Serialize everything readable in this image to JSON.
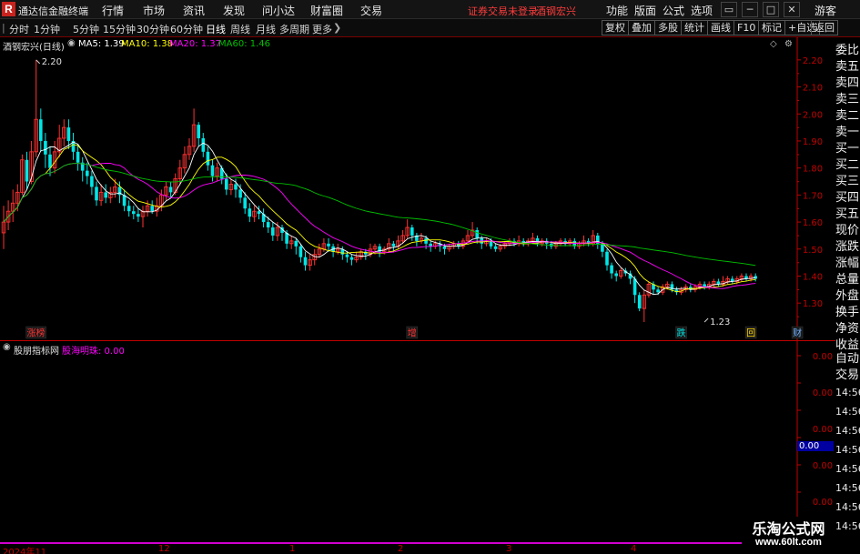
{
  "titlebar": {
    "logo": "R",
    "app_title": "通达信金融终端",
    "menu": [
      "行情",
      "市场",
      "资讯",
      "发现",
      "问小达",
      "财富圈",
      "交易"
    ],
    "warning": "证券交易未登录",
    "stock_name": "酒钢宏兴",
    "right_menu": [
      "功能",
      "版面",
      "公式",
      "选项"
    ],
    "guest_label": "游客",
    "window_buttons": [
      "▭",
      "─",
      "□",
      "✕"
    ]
  },
  "toolbar": {
    "periods": [
      "分时",
      "1分钟",
      "5分钟",
      "15分钟",
      "30分钟",
      "60分钟",
      "日线",
      "周线",
      "月线",
      "多周期",
      "更多"
    ],
    "active_period": "日线",
    "right_buttons": [
      "复权",
      "叠加",
      "多股",
      "统计",
      "画线",
      "F10",
      "标记",
      "+自选",
      "返回"
    ]
  },
  "chart_header": {
    "stock_label": "酒钢宏兴(日线)",
    "ma5": "MA5: 1.39",
    "ma10": "MA10: 1.38",
    "ma20": "MA20: 1.37",
    "ma60": "MA60: 1.46"
  },
  "indicator_header": {
    "name": "股朋指标网",
    "series_label": "股海明珠: 0.00",
    "current_value": "0.00"
  },
  "sidebar": {
    "items": [
      "委比",
      "卖五",
      "卖四",
      "卖三",
      "卖二",
      "卖一",
      "买一",
      "买二",
      "买三",
      "买四",
      "买五",
      "现价",
      "涨跌",
      "涨幅",
      "总量",
      "外盘",
      "换手",
      "净资",
      "收益"
    ],
    "bottom_items": [
      "自动",
      "交易"
    ],
    "times": [
      "14:56",
      "14:56",
      "14:56",
      "14:56",
      "14:56",
      "14:56",
      "14:56",
      "14:56"
    ]
  },
  "date_axis": {
    "labels": [
      "2024年11",
      "12",
      "1",
      "2",
      "3",
      "4"
    ]
  },
  "watermark": {
    "line1": "乐淘公式网",
    "line2": "www.60lt.com"
  },
  "colors": {
    "up": "#ff3232",
    "down": "#00e6e6",
    "ma5": "#ffffff",
    "ma10": "#ffff00",
    "ma20": "#ff00ff",
    "ma60": "#00c000",
    "axis_red": "#c00000"
  },
  "chart_data": [
    {
      "type": "candlestick",
      "title": "酒钢宏兴(日线)",
      "y_ticks": [
        1.3,
        1.4,
        1.5,
        1.6,
        1.7,
        1.8,
        1.9,
        2.0,
        2.1,
        2.2
      ],
      "ylim": [
        1.24,
        2.25
      ],
      "annotations": [
        {
          "text": "2.20",
          "value": 2.2,
          "index": 7
        },
        {
          "text": "1.23",
          "value": 1.23,
          "index": 151
        }
      ],
      "markers": [
        {
          "text": "涨榜",
          "index": 6,
          "color": "#ff3232"
        },
        {
          "text": "增",
          "index": 88,
          "color": "#ff3232"
        },
        {
          "text": "跌",
          "index": 146,
          "color": "#00e6e6"
        },
        {
          "text": "回",
          "index": 161,
          "color": "#ffd700"
        },
        {
          "text": "财",
          "index": 171,
          "color": "#6fb0ff"
        }
      ],
      "series": [
        {
          "name": "MA5",
          "value": 1.39
        },
        {
          "name": "MA10",
          "value": 1.38
        },
        {
          "name": "MA20",
          "value": 1.37
        },
        {
          "name": "MA60",
          "value": 1.46
        }
      ],
      "candles": [
        [
          1.56,
          1.6,
          1.66,
          1.5
        ],
        [
          1.6,
          1.64,
          1.68,
          1.57
        ],
        [
          1.64,
          1.67,
          1.72,
          1.6
        ],
        [
          1.67,
          1.71,
          1.74,
          1.64
        ],
        [
          1.71,
          1.83,
          1.85,
          1.7
        ],
        [
          1.83,
          1.75,
          1.86,
          1.72
        ],
        [
          1.75,
          1.86,
          1.9,
          1.74
        ],
        [
          1.86,
          1.98,
          2.2,
          1.84
        ],
        [
          1.98,
          1.9,
          2.02,
          1.86
        ],
        [
          1.9,
          1.85,
          1.93,
          1.8
        ],
        [
          1.85,
          1.8,
          1.88,
          1.77
        ],
        [
          1.8,
          1.86,
          1.9,
          1.78
        ],
        [
          1.86,
          1.91,
          1.96,
          1.84
        ],
        [
          1.91,
          1.95,
          1.98,
          1.88
        ],
        [
          1.95,
          1.9,
          1.98,
          1.87
        ],
        [
          1.9,
          1.86,
          1.93,
          1.83
        ],
        [
          1.86,
          1.82,
          1.89,
          1.79
        ],
        [
          1.82,
          1.79,
          1.84,
          1.75
        ],
        [
          1.79,
          1.77,
          1.82,
          1.74
        ],
        [
          1.77,
          1.73,
          1.79,
          1.7
        ],
        [
          1.73,
          1.68,
          1.75,
          1.66
        ],
        [
          1.68,
          1.71,
          1.74,
          1.66
        ],
        [
          1.71,
          1.69,
          1.74,
          1.67
        ],
        [
          1.69,
          1.71,
          1.73,
          1.67
        ],
        [
          1.71,
          1.73,
          1.76,
          1.69
        ],
        [
          1.73,
          1.7,
          1.75,
          1.67
        ],
        [
          1.7,
          1.66,
          1.72,
          1.64
        ],
        [
          1.66,
          1.64,
          1.68,
          1.62
        ],
        [
          1.64,
          1.63,
          1.66,
          1.61
        ],
        [
          1.63,
          1.62,
          1.65,
          1.6
        ],
        [
          1.62,
          1.64,
          1.66,
          1.58
        ],
        [
          1.64,
          1.66,
          1.68,
          1.62
        ],
        [
          1.66,
          1.64,
          1.68,
          1.63
        ],
        [
          1.64,
          1.66,
          1.69,
          1.62
        ],
        [
          1.66,
          1.7,
          1.72,
          1.64
        ],
        [
          1.7,
          1.73,
          1.75,
          1.68
        ],
        [
          1.73,
          1.71,
          1.75,
          1.69
        ],
        [
          1.71,
          1.76,
          1.78,
          1.7
        ],
        [
          1.76,
          1.8,
          1.83,
          1.74
        ],
        [
          1.8,
          1.85,
          1.88,
          1.78
        ],
        [
          1.85,
          1.88,
          1.91,
          1.83
        ],
        [
          1.88,
          1.96,
          2.02,
          1.86
        ],
        [
          1.96,
          1.91,
          1.97,
          1.88
        ],
        [
          1.91,
          1.86,
          1.93,
          1.84
        ],
        [
          1.86,
          1.81,
          1.88,
          1.79
        ],
        [
          1.81,
          1.77,
          1.83,
          1.75
        ],
        [
          1.77,
          1.8,
          1.82,
          1.75
        ],
        [
          1.8,
          1.76,
          1.81,
          1.74
        ],
        [
          1.76,
          1.72,
          1.78,
          1.7
        ],
        [
          1.72,
          1.74,
          1.76,
          1.7
        ],
        [
          1.74,
          1.72,
          1.76,
          1.69
        ],
        [
          1.72,
          1.69,
          1.74,
          1.67
        ],
        [
          1.69,
          1.65,
          1.71,
          1.63
        ],
        [
          1.65,
          1.62,
          1.67,
          1.6
        ],
        [
          1.62,
          1.64,
          1.66,
          1.6
        ],
        [
          1.64,
          1.63,
          1.66,
          1.61
        ],
        [
          1.63,
          1.6,
          1.65,
          1.58
        ],
        [
          1.6,
          1.58,
          1.62,
          1.56
        ],
        [
          1.58,
          1.55,
          1.6,
          1.53
        ],
        [
          1.55,
          1.58,
          1.6,
          1.53
        ],
        [
          1.58,
          1.56,
          1.59,
          1.53
        ],
        [
          1.56,
          1.52,
          1.57,
          1.5
        ],
        [
          1.52,
          1.53,
          1.55,
          1.5
        ],
        [
          1.53,
          1.51,
          1.54,
          1.48
        ],
        [
          1.51,
          1.47,
          1.52,
          1.45
        ],
        [
          1.47,
          1.44,
          1.49,
          1.42
        ],
        [
          1.44,
          1.46,
          1.48,
          1.42
        ],
        [
          1.46,
          1.48,
          1.5,
          1.44
        ],
        [
          1.48,
          1.5,
          1.52,
          1.47
        ],
        [
          1.5,
          1.52,
          1.54,
          1.49
        ],
        [
          1.52,
          1.51,
          1.54,
          1.49
        ],
        [
          1.51,
          1.49,
          1.52,
          1.47
        ],
        [
          1.49,
          1.5,
          1.52,
          1.48
        ],
        [
          1.5,
          1.48,
          1.51,
          1.46
        ],
        [
          1.48,
          1.47,
          1.49,
          1.45
        ],
        [
          1.47,
          1.46,
          1.48,
          1.44
        ],
        [
          1.46,
          1.47,
          1.49,
          1.45
        ],
        [
          1.47,
          1.49,
          1.5,
          1.46
        ],
        [
          1.49,
          1.48,
          1.5,
          1.46
        ],
        [
          1.48,
          1.5,
          1.52,
          1.47
        ],
        [
          1.5,
          1.51,
          1.52,
          1.48
        ],
        [
          1.51,
          1.49,
          1.52,
          1.47
        ],
        [
          1.49,
          1.5,
          1.51,
          1.48
        ],
        [
          1.5,
          1.52,
          1.54,
          1.49
        ],
        [
          1.52,
          1.51,
          1.53,
          1.49
        ],
        [
          1.51,
          1.53,
          1.55,
          1.5
        ],
        [
          1.53,
          1.55,
          1.57,
          1.52
        ],
        [
          1.55,
          1.58,
          1.61,
          1.54
        ],
        [
          1.58,
          1.55,
          1.59,
          1.53
        ],
        [
          1.55,
          1.53,
          1.56,
          1.51
        ],
        [
          1.53,
          1.54,
          1.56,
          1.52
        ],
        [
          1.54,
          1.52,
          1.55,
          1.5
        ],
        [
          1.52,
          1.51,
          1.53,
          1.49
        ],
        [
          1.51,
          1.52,
          1.53,
          1.5
        ],
        [
          1.52,
          1.51,
          1.53,
          1.49
        ],
        [
          1.51,
          1.5,
          1.52,
          1.48
        ],
        [
          1.5,
          1.51,
          1.52,
          1.49
        ],
        [
          1.51,
          1.52,
          1.53,
          1.5
        ],
        [
          1.52,
          1.51,
          1.53,
          1.5
        ],
        [
          1.51,
          1.53,
          1.54,
          1.5
        ],
        [
          1.53,
          1.55,
          1.57,
          1.52
        ],
        [
          1.55,
          1.57,
          1.6,
          1.54
        ],
        [
          1.57,
          1.54,
          1.58,
          1.52
        ],
        [
          1.54,
          1.52,
          1.55,
          1.5
        ],
        [
          1.52,
          1.53,
          1.54,
          1.51
        ],
        [
          1.53,
          1.51,
          1.54,
          1.5
        ],
        [
          1.51,
          1.5,
          1.52,
          1.49
        ],
        [
          1.5,
          1.51,
          1.52,
          1.49
        ],
        [
          1.51,
          1.52,
          1.53,
          1.5
        ],
        [
          1.52,
          1.53,
          1.54,
          1.51
        ],
        [
          1.53,
          1.52,
          1.54,
          1.51
        ],
        [
          1.52,
          1.53,
          1.55,
          1.51
        ],
        [
          1.53,
          1.52,
          1.54,
          1.51
        ],
        [
          1.52,
          1.53,
          1.54,
          1.51
        ],
        [
          1.53,
          1.54,
          1.56,
          1.52
        ],
        [
          1.54,
          1.52,
          1.55,
          1.51
        ],
        [
          1.52,
          1.53,
          1.54,
          1.51
        ],
        [
          1.53,
          1.52,
          1.54,
          1.5
        ],
        [
          1.52,
          1.51,
          1.53,
          1.5
        ],
        [
          1.51,
          1.52,
          1.53,
          1.5
        ],
        [
          1.52,
          1.53,
          1.54,
          1.51
        ],
        [
          1.53,
          1.52,
          1.54,
          1.51
        ],
        [
          1.52,
          1.53,
          1.54,
          1.51
        ],
        [
          1.53,
          1.51,
          1.54,
          1.5
        ],
        [
          1.51,
          1.52,
          1.53,
          1.5
        ],
        [
          1.52,
          1.53,
          1.55,
          1.51
        ],
        [
          1.53,
          1.52,
          1.54,
          1.51
        ],
        [
          1.52,
          1.55,
          1.57,
          1.51
        ],
        [
          1.55,
          1.52,
          1.56,
          1.5
        ],
        [
          1.52,
          1.49,
          1.53,
          1.47
        ],
        [
          1.49,
          1.44,
          1.5,
          1.42
        ],
        [
          1.44,
          1.41,
          1.45,
          1.39
        ],
        [
          1.41,
          1.4,
          1.42,
          1.38
        ],
        [
          1.4,
          1.42,
          1.43,
          1.39
        ],
        [
          1.42,
          1.41,
          1.43,
          1.4
        ],
        [
          1.41,
          1.39,
          1.42,
          1.37
        ],
        [
          1.39,
          1.33,
          1.4,
          1.3
        ],
        [
          1.33,
          1.28,
          1.34,
          1.27
        ],
        [
          1.28,
          1.33,
          1.35,
          1.23
        ],
        [
          1.33,
          1.37,
          1.38,
          1.32
        ],
        [
          1.37,
          1.35,
          1.38,
          1.33
        ],
        [
          1.35,
          1.34,
          1.36,
          1.33
        ],
        [
          1.34,
          1.36,
          1.37,
          1.33
        ],
        [
          1.36,
          1.37,
          1.38,
          1.35
        ],
        [
          1.37,
          1.35,
          1.38,
          1.34
        ],
        [
          1.35,
          1.34,
          1.36,
          1.33
        ],
        [
          1.34,
          1.35,
          1.36,
          1.33
        ],
        [
          1.35,
          1.36,
          1.37,
          1.34
        ],
        [
          1.36,
          1.35,
          1.37,
          1.34
        ],
        [
          1.35,
          1.36,
          1.37,
          1.34
        ],
        [
          1.36,
          1.37,
          1.38,
          1.35
        ],
        [
          1.37,
          1.36,
          1.38,
          1.35
        ],
        [
          1.36,
          1.37,
          1.38,
          1.35
        ],
        [
          1.37,
          1.38,
          1.39,
          1.36
        ],
        [
          1.38,
          1.37,
          1.39,
          1.36
        ],
        [
          1.37,
          1.38,
          1.4,
          1.36
        ],
        [
          1.38,
          1.39,
          1.4,
          1.37
        ],
        [
          1.39,
          1.38,
          1.4,
          1.37
        ],
        [
          1.38,
          1.39,
          1.4,
          1.37
        ],
        [
          1.39,
          1.4,
          1.41,
          1.38
        ],
        [
          1.4,
          1.39,
          1.41,
          1.38
        ],
        [
          1.39,
          1.4,
          1.41,
          1.38
        ],
        [
          1.4,
          1.39,
          1.41,
          1.38
        ]
      ]
    },
    {
      "type": "line",
      "title": "股朋指标网",
      "y_ticks": [
        0.0,
        0.0,
        0.0,
        0.0,
        0.0,
        0.0
      ],
      "series": [
        {
          "name": "股海明珠",
          "value": 0.0
        }
      ]
    }
  ]
}
